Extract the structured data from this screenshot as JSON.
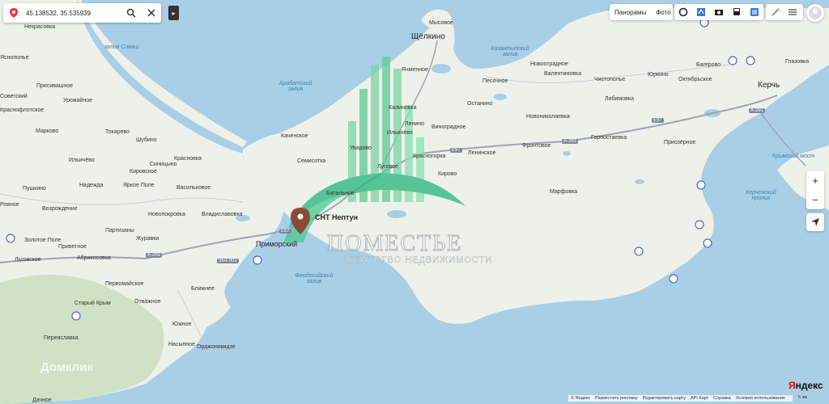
{
  "search": {
    "value": "45.138532, 35.535939"
  },
  "toolbar": {
    "panoramas": "Панорамы",
    "photo": "Фото"
  },
  "brand": {
    "ya": "Я",
    "ndex": "ндекс"
  },
  "scale_label": "5 км",
  "footer": {
    "links": [
      "© Яндекс",
      "Разместить рекламу",
      "Редактировать карту",
      "API Карт",
      "Справка",
      "Условия использования"
    ]
  },
  "watermark": {
    "title": "ПОМЕСТЬЕ",
    "subtitle": "АГЕНТСТВО НЕДВИЖИМОСТИ",
    "corner": "Домклик"
  },
  "marker": {
    "label": "СНТ Нептун"
  },
  "colors": {
    "marker": "#8a4b36",
    "land": "#eef1ea",
    "water": "#a9cfe6",
    "road": "#9aa6b5"
  },
  "icons": [
    "location-pin-icon",
    "search-icon",
    "close-icon",
    "panorama-icon",
    "traffic-icon",
    "camera-icon",
    "bus-icon",
    "layers-icon",
    "ruler-icon",
    "profile-icon",
    "zoom-in-icon",
    "zoom-out-icon",
    "locate-icon"
  ],
  "places": {
    "big": [
      {
        "id": "kerch",
        "name": "Керчь"
      },
      {
        "id": "shchelkino",
        "name": "Щёлкино"
      }
    ],
    "mid": [
      {
        "id": "primorsky",
        "name": "Приморский"
      }
    ],
    "small": [
      {
        "id": "nekrasovka",
        "name": "Некрасовка"
      },
      {
        "id": "yasnopole",
        "name": "Яснополье"
      },
      {
        "id": "soviet",
        "name": "Советский"
      },
      {
        "id": "prisivashnoe",
        "name": "Присивашное"
      },
      {
        "id": "urozhaynoe",
        "name": "Урожайное"
      },
      {
        "id": "krasnoflotskoe",
        "name": "Краснофлотское"
      },
      {
        "id": "markovo",
        "name": "Марково"
      },
      {
        "id": "tokarevo",
        "name": "Токарево"
      },
      {
        "id": "shubino",
        "name": "Шубино"
      },
      {
        "id": "ilichevo1",
        "name": "Ильичёво"
      },
      {
        "id": "krasnovka",
        "name": "Красновка"
      },
      {
        "id": "sinitsyno",
        "name": "Синицыно"
      },
      {
        "id": "kirovskoe",
        "name": "Кировское"
      },
      {
        "id": "nadezhda",
        "name": "Надежда"
      },
      {
        "id": "yarkoepole",
        "name": "Яркое Поле"
      },
      {
        "id": "vasilkovoe",
        "name": "Васильковое"
      },
      {
        "id": "pushkino",
        "name": "Пушкино"
      },
      {
        "id": "rovnoe",
        "name": "Ровное"
      },
      {
        "id": "vozrozhdenie",
        "name": "Возрождение"
      },
      {
        "id": "novopokrovka",
        "name": "Новопокровка"
      },
      {
        "id": "vladislavovka",
        "name": "Владиславовка"
      },
      {
        "id": "partizany",
        "name": "Партизаны"
      },
      {
        "id": "zuravki",
        "name": "Журавки"
      },
      {
        "id": "zolotoepole",
        "name": "Золотое Поле"
      },
      {
        "id": "privetnoe",
        "name": "Приветное"
      },
      {
        "id": "lgovskoe",
        "name": "Льговское"
      },
      {
        "id": "abrikosovka",
        "name": "Абрикосовка"
      },
      {
        "id": "pervomayskoe",
        "name": "Первомайское"
      },
      {
        "id": "stariykrym",
        "name": "Старый Крым"
      },
      {
        "id": "otvazhnoe",
        "name": "Отважное"
      },
      {
        "id": "blizhnee",
        "name": "Ближнее"
      },
      {
        "id": "yuzhnoe",
        "name": "Южное"
      },
      {
        "id": "pereyaslavka",
        "name": "Переяславка"
      },
      {
        "id": "nasypnoe",
        "name": "Насыпное"
      },
      {
        "id": "ordzhonikidze",
        "name": "Орджоникидзе"
      },
      {
        "id": "dachnoe",
        "name": "Дачное"
      },
      {
        "id": "kachenskoe",
        "name": "Каченское"
      },
      {
        "id": "semisotka",
        "name": "Семисотка"
      },
      {
        "id": "uvarovo",
        "name": "Уварово"
      },
      {
        "id": "lugovoe",
        "name": "Луговое"
      },
      {
        "id": "batalnoe",
        "name": "Батальное"
      },
      {
        "id": "kalinovka",
        "name": "Калиновка"
      },
      {
        "id": "lenino",
        "name": "Ленино"
      },
      {
        "id": "ilichevo2",
        "name": "Ильичёво"
      },
      {
        "id": "vinogradnoe",
        "name": "Виноградное"
      },
      {
        "id": "krasnogorka",
        "name": "Красногорка"
      },
      {
        "id": "kirovo",
        "name": "Кирово"
      },
      {
        "id": "mysovoe",
        "name": "Мысовое"
      },
      {
        "id": "novootradnoe",
        "name": "Новоотрадное"
      },
      {
        "id": "yachmennoe",
        "name": "Ячменное"
      },
      {
        "id": "pesochnoe",
        "name": "Песочное"
      },
      {
        "id": "ostanino",
        "name": "Останино"
      },
      {
        "id": "novonikolaevka",
        "name": "Новониколаевка"
      },
      {
        "id": "leninskoe",
        "name": "Ленинское"
      },
      {
        "id": "fronovoe",
        "name": "Фронтовое"
      },
      {
        "id": "gornostaevka",
        "name": "Горностаевка"
      },
      {
        "id": "marfovka",
        "name": "Марфовка"
      },
      {
        "id": "chistopole",
        "name": "Чистополье"
      },
      {
        "id": "valentinovka",
        "name": "Валентиновка"
      },
      {
        "id": "yurkino",
        "name": "Юркино"
      },
      {
        "id": "oktyabrskoe",
        "name": "Октябрьское"
      },
      {
        "id": "glazovka",
        "name": "Глазовка"
      },
      {
        "id": "ljubimovka",
        "name": "Либимовка"
      },
      {
        "id": "priozernoe",
        "name": "Приозёрное"
      },
      {
        "id": "bagerovo",
        "name": "Багерово"
      }
    ],
    "water": [
      {
        "id": "sivash",
        "name": "залив Сиваш"
      },
      {
        "id": "arabat",
        "name": "Арабатский залив"
      },
      {
        "id": "kazantip",
        "name": "Казантипский залив"
      },
      {
        "id": "feodosia",
        "name": "Феодосийский залив"
      },
      {
        "id": "kerchstrait",
        "name": "Керченский пролив"
      },
      {
        "id": "kerchbridge",
        "name": "Крымский мост"
      }
    ],
    "roads": [
      {
        "id": "r1",
        "name": "А-291"
      },
      {
        "id": "r2",
        "name": "Е97"
      },
      {
        "id": "r3",
        "name": "А-291"
      },
      {
        "id": "r4",
        "name": "35А-001"
      },
      {
        "id": "r5",
        "name": "Е97"
      },
      {
        "id": "r6",
        "name": "А-291"
      },
      {
        "id": "r7",
        "name": "Е97"
      },
      {
        "id": "r8",
        "name": "А-291"
      }
    ]
  }
}
